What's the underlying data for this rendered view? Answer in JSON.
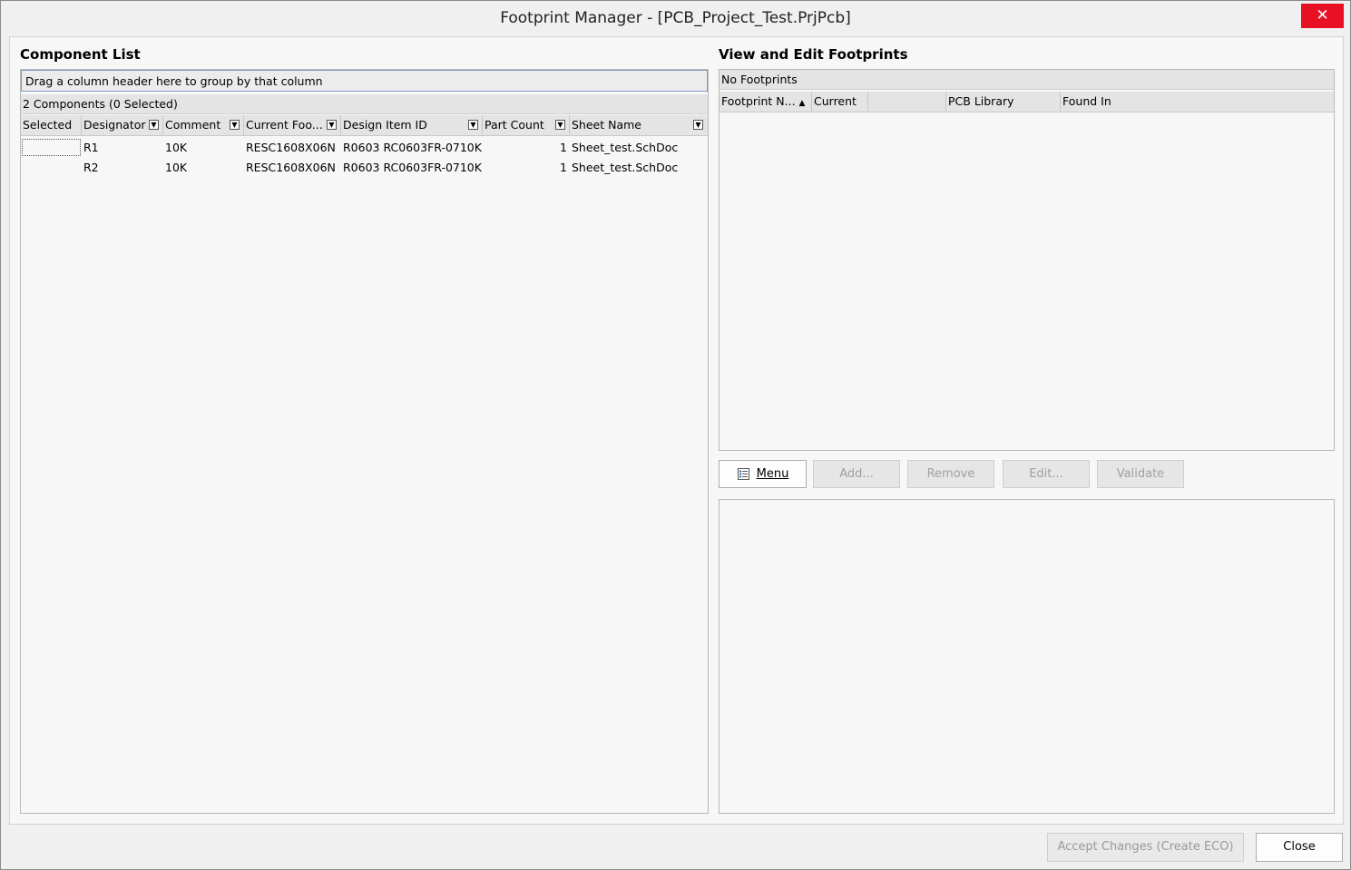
{
  "window": {
    "title": "Footprint Manager - [PCB_Project_Test.PrjPcb]",
    "close_glyph": "✕"
  },
  "component_list": {
    "heading": "Component List",
    "group_hint": "Drag a column header here to group by that column",
    "count_label": "2 Components (0 Selected)",
    "columns": [
      "Selected",
      "Designator",
      "Comment",
      "Current Foo...",
      "Design Item ID",
      "Part Count",
      "Sheet Name"
    ],
    "rows": [
      {
        "selected": "",
        "designator": "R1",
        "comment": "10K",
        "current_footprint": "RESC1608X06N",
        "design_item_id": "R0603 RC0603FR-0710K",
        "part_count": "1",
        "sheet_name": "Sheet_test.SchDoc"
      },
      {
        "selected": "",
        "designator": "R2",
        "comment": "10K",
        "current_footprint": "RESC1608X06N",
        "design_item_id": "R0603 RC0603FR-0710K",
        "part_count": "1",
        "sheet_name": "Sheet_test.SchDoc"
      }
    ]
  },
  "footprints": {
    "heading": "View and Edit Footprints",
    "no_footprints": "No Footprints",
    "columns": [
      "Footprint N...",
      "Current",
      "PCB Library",
      "Found In"
    ],
    "sort_glyph": "▲"
  },
  "buttons": {
    "menu": "Menu",
    "add": "Add...",
    "remove": "Remove",
    "edit": "Edit...",
    "validate": "Validate"
  },
  "footer": {
    "accept": "Accept Changes (Create ECO)",
    "close": "Close"
  },
  "icons": {
    "filter": "filter-icon",
    "menu": "menu-icon",
    "close": "close-icon"
  }
}
